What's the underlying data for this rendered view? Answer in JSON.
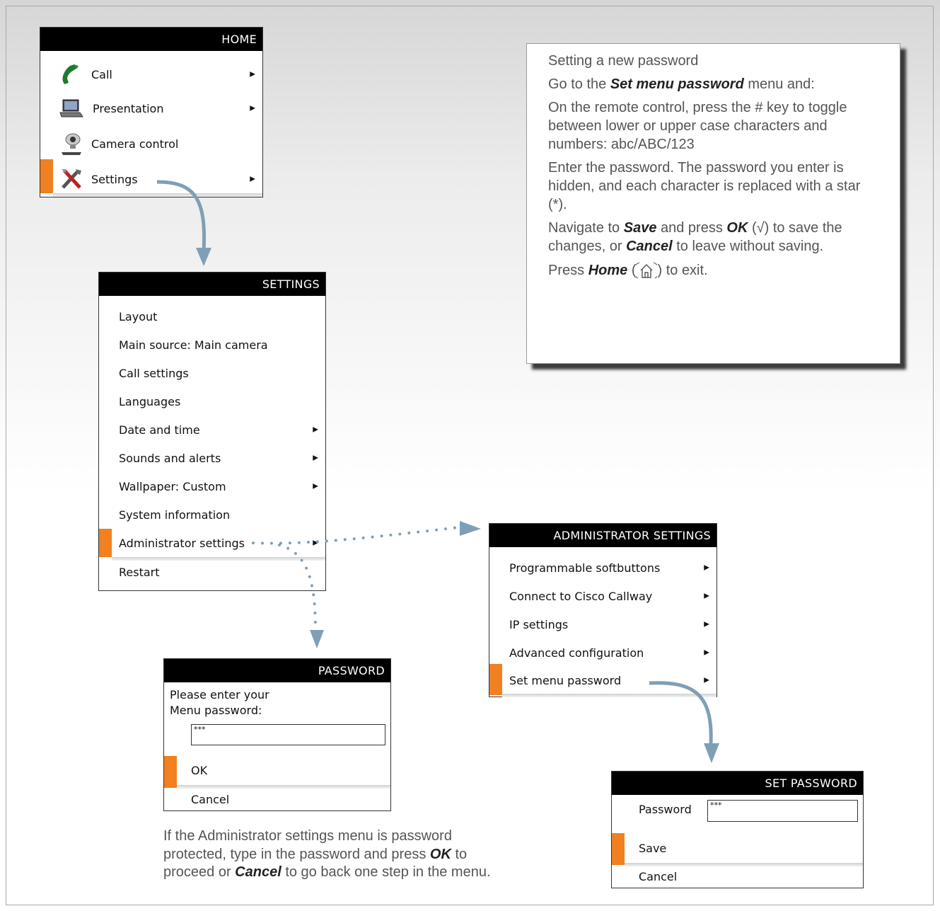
{
  "home_menu": {
    "title": "HOME",
    "items": [
      {
        "label": "Call",
        "icon": "phone-handset-icon"
      },
      {
        "label": "Presentation",
        "icon": "laptop-icon"
      },
      {
        "label": "Camera control",
        "icon": "camera-icon"
      },
      {
        "label": "Settings",
        "icon": "tools-icon"
      }
    ]
  },
  "settings_menu": {
    "title": "SETTINGS",
    "items": [
      {
        "label": "Layout"
      },
      {
        "label": "Main source: Main camera"
      },
      {
        "label": "Call settings"
      },
      {
        "label": "Languages"
      },
      {
        "label": "Date and time"
      },
      {
        "label": "Sounds and alerts"
      },
      {
        "label": "Wallpaper: Custom"
      },
      {
        "label": "System information"
      },
      {
        "label": "Administrator settings"
      },
      {
        "label": "Restart"
      }
    ]
  },
  "admin_menu": {
    "title": "ADMINISTRATOR SETTINGS",
    "items": [
      {
        "label": "Programmable softbuttons"
      },
      {
        "label": "Connect to Cisco Callway"
      },
      {
        "label": "IP settings"
      },
      {
        "label": "Advanced configuration"
      },
      {
        "label": "Set menu password"
      }
    ]
  },
  "password_dialog": {
    "title": "PASSWORD",
    "prompt_line1": "Please enter your",
    "prompt_line2": "Menu password:",
    "input_value": "***",
    "ok_label": "OK",
    "cancel_label": "Cancel"
  },
  "set_password_dialog": {
    "title": "SET PASSWORD",
    "field_label": "Password",
    "input_value": "***",
    "save_label": "Save",
    "cancel_label": "Cancel"
  },
  "info": {
    "heading": "Setting a new password",
    "p1_pre": "Go to the ",
    "p1_em": "Set menu password",
    "p1_post": " menu and:",
    "p2": "On the remote control, press the # key to toggle between lower or upper case characters and numbers: abc/ABC/123",
    "p3": "Enter the password. The password you enter is hidden, and each character is replaced with a star (*).",
    "p4_a": "Navigate to ",
    "p4_save": "Save",
    "p4_b": " and press ",
    "p4_ok": "OK",
    "p4_c": " (√) to save the changes, or ",
    "p4_cancel": "Cancel",
    "p4_d": " to leave without saving.",
    "p5_a": "Press ",
    "p5_home": "Home",
    "p5_b": " (",
    "p5_c": ") to exit."
  },
  "caption": {
    "a": "If the Administrator settings menu is password protected, type in the password and press ",
    "ok": "OK",
    "b": " to proceed or ",
    "cancel": "Cancel",
    "c": " to go back one step in the menu."
  },
  "colors": {
    "selection": "#f08020",
    "header": "#000000",
    "connector": "#7f9fb6"
  }
}
